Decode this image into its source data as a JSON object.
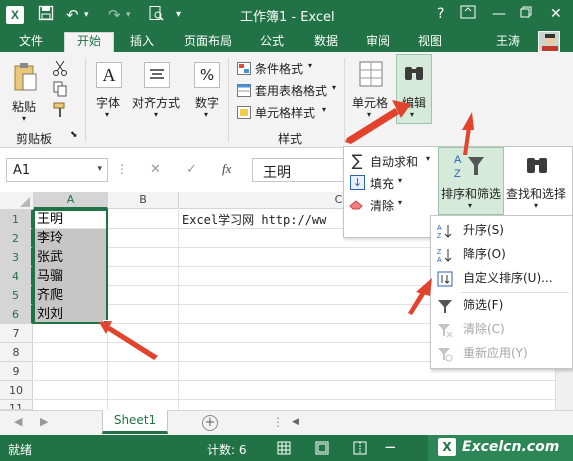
{
  "window": {
    "title": "工作簿1 - Excel",
    "help": "?"
  },
  "tabs": {
    "file": "文件",
    "items": [
      "开始",
      "插入",
      "页面布局",
      "公式",
      "数据",
      "审阅",
      "视图"
    ],
    "user": "王涛"
  },
  "ribbon": {
    "paste": "粘贴",
    "clipboard_group": "剪贴板",
    "font": "字体",
    "align": "对齐方式",
    "number": "数字",
    "number_symbol": "%",
    "cond_format": "条件格式",
    "table_format": "套用表格格式",
    "cell_style": "单元格样式",
    "styles_group": "样式",
    "cells": "单元格",
    "edit": "编辑"
  },
  "formula_bar": {
    "name_box": "A1",
    "cancel": "✕",
    "enter": "✓",
    "fx": "fx",
    "content": "王明"
  },
  "grid": {
    "columns": [
      "A",
      "B",
      "C"
    ],
    "rows": [
      "1",
      "2",
      "3",
      "4",
      "5",
      "6",
      "7",
      "8",
      "9",
      "10",
      "11"
    ],
    "a_values": [
      "王明",
      "李玲",
      "张武",
      "马骝",
      "齐爬",
      "刘刘"
    ],
    "c1_value": "Excel学习网 http://ww"
  },
  "edit_panel": {
    "autosum": "自动求和",
    "fill": "填充",
    "clear": "清除",
    "sort_filter": "排序和筛选",
    "find_select": "查找和选择"
  },
  "sort_menu": [
    {
      "label": "升序(S)",
      "enabled": true
    },
    {
      "label": "降序(O)",
      "enabled": true
    },
    {
      "label": "自定义排序(U)...",
      "enabled": true
    },
    {
      "label": "筛选(F)",
      "enabled": true
    },
    {
      "label": "清除(C)",
      "enabled": false
    },
    {
      "label": "重新应用(Y)",
      "enabled": false
    }
  ],
  "sheet_tab": "Sheet1",
  "status": {
    "ready": "就绪",
    "count": "计数: 6"
  },
  "watermark": "Excelcn.com",
  "colors": {
    "excel_green": "#217346",
    "selection": "#c6c6c6",
    "highlight": "#d5eadb",
    "arrow": "#e2432c"
  }
}
